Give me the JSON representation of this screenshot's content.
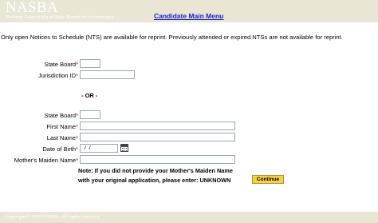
{
  "header": {
    "logo_word": "NASBA",
    "logo_subtitle": "National Association of State Boards of Accountancy",
    "main_menu_link": "Candidate Main Menu"
  },
  "notice": "Only open Notices to Schedule (NTS) are available for reprint.  Previously attended or expired NTSs are not available for reprint.",
  "form": {
    "required_marker": "*",
    "section1": {
      "state_board_label": "State Board",
      "state_board_value": "",
      "jurisdiction_id_label": "Jurisdiction ID",
      "jurisdiction_id_value": ""
    },
    "separator": "- OR -",
    "section2": {
      "state_board_label": "State Board",
      "state_board_value": "",
      "first_name_label": "First Name",
      "first_name_value": "",
      "last_name_label": "Last Name",
      "last_name_value": "",
      "date_of_birth_label": "Date of Birth",
      "date_of_birth_value": " /  /",
      "calendar_icon": "calendar-icon",
      "mothers_maiden_name_label": "Mother's Maiden Name",
      "mothers_maiden_name_value": ""
    },
    "note_line1": "Note: If you did not provide your Mother's Maiden Name",
    "note_line2": "with your original application, please enter: UNKNOWN",
    "continue_button": "Continue"
  },
  "footer": {
    "copyright": "Copyright© 2003 NASBA.  All rights reserved."
  },
  "colors": {
    "header_bar": "#e9e6d6",
    "link": "#1b22c8",
    "required_asterisk": "#cc0000",
    "continue_button": "#f3d24a"
  }
}
